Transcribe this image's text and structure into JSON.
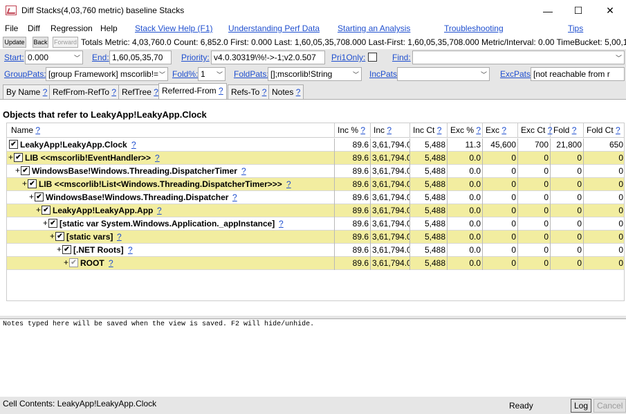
{
  "window": {
    "title": "Diff  Stacks(4,03,760 metric) baseline  Stacks",
    "minimize": "—",
    "maximize": "☐",
    "close": "✕"
  },
  "menu": {
    "file": "File",
    "diff": "Diff",
    "regression": "Regression",
    "help": "Help",
    "links": [
      "Stack View Help (F1)",
      "Understanding Perf Data",
      "Starting an Analysis",
      "Troubleshooting",
      "Tips"
    ]
  },
  "toolbar": {
    "update": "Update",
    "back": "Back",
    "forward": "Forward",
    "stats": "Totals Metric: 4,03,760.0  Count: 6,852.0  First: 0.000  Last: 1,60,05,35,708.000  Last-First: 1,60,05,35,708.000  Metric/Interval: 0.00  TimeBucket: 5,00,16,7"
  },
  "filters": {
    "start_label": "Start:",
    "start_value": "0.000",
    "end_label": "End:",
    "end_value": "1,60,05,35,70",
    "priority_label": "Priority:",
    "priority_value": "v4.0.30319\\%!->-1;v2.0.507",
    "pri1only_label": "Pri1Only:",
    "find_label": "Find:",
    "find_value": "",
    "grouppats_label": "GroupPats:",
    "grouppats_value": "[group Framework] mscorlib!=",
    "foldpct_label": "Fold%:",
    "foldpct_value": "1",
    "foldpats_label": "FoldPats:",
    "foldpats_value": "[];mscorlib!String",
    "incpats_label": "IncPats:",
    "incpats_value": "",
    "excpats_label": "ExcPats:",
    "excpats_value": "[not reachable from r"
  },
  "tabs": [
    {
      "label": "By Name",
      "q": "?"
    },
    {
      "label": "RefFrom-RefTo",
      "q": "?"
    },
    {
      "label": "RefTree",
      "q": "?"
    },
    {
      "label": "Referred-From",
      "q": "?"
    },
    {
      "label": "Refs-To",
      "q": "?"
    },
    {
      "label": "Notes",
      "q": "?"
    }
  ],
  "heading": "Objects that refer to LeakyApp!LeakyApp.Clock",
  "columns": [
    {
      "label": "Name",
      "q": "?"
    },
    {
      "label": "Inc %",
      "q": "?"
    },
    {
      "label": "Inc",
      "q": "?"
    },
    {
      "label": "Inc Ct",
      "q": "?"
    },
    {
      "label": "Exc %",
      "q": "?"
    },
    {
      "label": "Exc",
      "q": "?"
    },
    {
      "label": "Exc Ct",
      "q": "?"
    },
    {
      "label": "Fold",
      "q": "?"
    },
    {
      "label": "Fold Ct",
      "q": "?"
    }
  ],
  "rows": [
    {
      "name": "LeakyApp!LeakyApp.Clock",
      "exp": "",
      "level": 0,
      "yellow": false,
      "vals": [
        "89.6",
        "3,61,794.0",
        "5,488",
        "11.3",
        "45,600",
        "700",
        "21,800",
        "650"
      ]
    },
    {
      "name": "LIB <<mscorlib!EventHandler>>",
      "exp": "+",
      "level": 0,
      "yellow": true,
      "vals": [
        "89.6",
        "3,61,794.0",
        "5,488",
        "0.0",
        "0",
        "0",
        "0",
        "0"
      ]
    },
    {
      "name": "WindowsBase!Windows.Threading.DispatcherTimer",
      "exp": "+",
      "level": 1,
      "yellow": false,
      "vals": [
        "89.6",
        "3,61,794.0",
        "5,488",
        "0.0",
        "0",
        "0",
        "0",
        "0"
      ]
    },
    {
      "name": "LIB <<mscorlib!List<Windows.Threading.DispatcherTimer>>>",
      "exp": "+",
      "level": 2,
      "yellow": true,
      "vals": [
        "89.6",
        "3,61,794.0",
        "5,488",
        "0.0",
        "0",
        "0",
        "0",
        "0"
      ]
    },
    {
      "name": "WindowsBase!Windows.Threading.Dispatcher",
      "exp": "+",
      "level": 3,
      "yellow": false,
      "vals": [
        "89.6",
        "3,61,794.0",
        "5,488",
        "0.0",
        "0",
        "0",
        "0",
        "0"
      ]
    },
    {
      "name": "LeakyApp!LeakyApp.App",
      "exp": "+",
      "level": 4,
      "yellow": true,
      "vals": [
        "89.6",
        "3,61,794.0",
        "5,488",
        "0.0",
        "0",
        "0",
        "0",
        "0"
      ]
    },
    {
      "name": "[static var System.Windows.Application._appInstance]",
      "exp": "+",
      "level": 5,
      "yellow": false,
      "vals": [
        "89.6",
        "3,61,794.0",
        "5,488",
        "0.0",
        "0",
        "0",
        "0",
        "0"
      ]
    },
    {
      "name": "[static vars]",
      "exp": "+",
      "level": 6,
      "yellow": true,
      "vals": [
        "89.6",
        "3,61,794.0",
        "5,488",
        "0.0",
        "0",
        "0",
        "0",
        "0"
      ]
    },
    {
      "name": "[.NET Roots]",
      "exp": "+",
      "level": 7,
      "yellow": false,
      "vals": [
        "89.6",
        "3,61,794.0",
        "5,488",
        "0.0",
        "0",
        "0",
        "0",
        "0"
      ]
    },
    {
      "name": "ROOT",
      "exp": "+",
      "level": 8,
      "yellow": true,
      "grey": true,
      "vals": [
        "89.6",
        "3,61,794.0",
        "5,488",
        "0.0",
        "0",
        "0",
        "0",
        "0"
      ]
    }
  ],
  "notes_text": "Notes typed here will be saved when the view is saved. F2 will hide/unhide.",
  "status": {
    "cell_contents": "Cell Contents: LeakyApp!LeakyApp.Clock",
    "ready": "Ready",
    "log": "Log",
    "cancel": "Cancel"
  },
  "colors": {
    "link": "#1f4fcf",
    "row_highlight": "#f2eda0",
    "chrome": "#e6e6e6"
  },
  "icons": {
    "check": "✔"
  }
}
